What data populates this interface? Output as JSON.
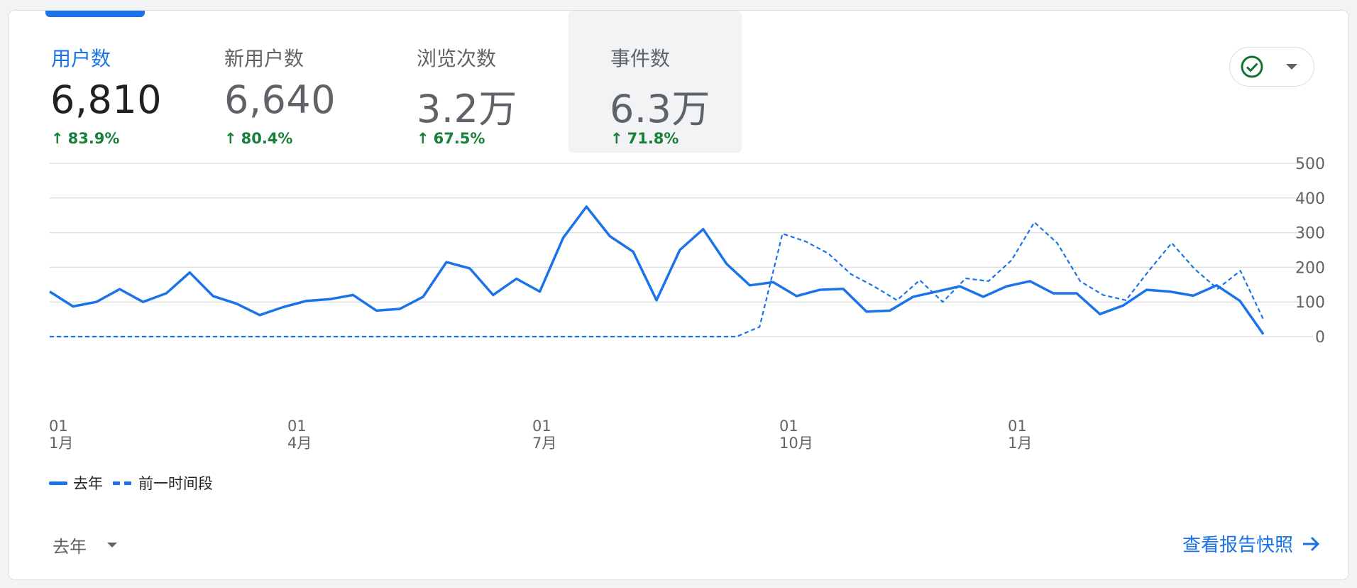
{
  "metrics": [
    {
      "label": "用户数",
      "value": "6,810",
      "change": "83.9%"
    },
    {
      "label": "新用户数",
      "value": "6,640",
      "change": "80.4%"
    },
    {
      "label": "浏览次数",
      "value": "3.2万",
      "change": "67.5%"
    },
    {
      "label": "事件数",
      "value": "6.3万",
      "change": "71.8%"
    }
  ],
  "colors": {
    "accent": "#1a73e8",
    "positive": "#188038",
    "text_muted": "#5f6368",
    "grid": "#e0e0e0"
  },
  "legend": {
    "current": "去年",
    "previous": "前一时间段"
  },
  "period": {
    "selected": "去年"
  },
  "report_link": {
    "label": "查看报告快照"
  },
  "chart_data": {
    "type": "line",
    "y_ticks": [
      "0",
      "100",
      "200",
      "300",
      "400",
      "500"
    ],
    "ylim": [
      0,
      500
    ],
    "x_ticks": [
      {
        "day": "01",
        "month": "1月"
      },
      {
        "day": "01",
        "month": "4月"
      },
      {
        "day": "01",
        "month": "7月"
      },
      {
        "day": "01",
        "month": "10月"
      },
      {
        "day": "01",
        "month": "1月"
      }
    ],
    "series": [
      {
        "name": "去年",
        "style": "solid",
        "values": [
          130,
          87,
          100,
          137,
          100,
          125,
          185,
          117,
          95,
          62,
          85,
          103,
          108,
          120,
          75,
          80,
          115,
          215,
          197,
          120,
          167,
          130,
          285,
          375,
          290,
          245,
          105,
          250,
          310,
          210,
          148,
          157,
          117,
          135,
          138,
          72,
          75,
          115,
          130,
          145,
          115,
          145,
          160,
          125,
          125,
          65,
          90,
          135,
          130,
          118,
          148,
          103,
          7
        ]
      },
      {
        "name": "前一时间段",
        "style": "dashed",
        "values": [
          0,
          0,
          0,
          0,
          0,
          0,
          0,
          0,
          0,
          0,
          0,
          0,
          0,
          0,
          0,
          0,
          0,
          0,
          0,
          0,
          0,
          0,
          0,
          0,
          0,
          0,
          0,
          0,
          0,
          0,
          0,
          28,
          297,
          275,
          240,
          180,
          145,
          105,
          163,
          100,
          168,
          160,
          220,
          330,
          270,
          160,
          120,
          105,
          190,
          270,
          195,
          138,
          190,
          50
        ]
      }
    ]
  }
}
